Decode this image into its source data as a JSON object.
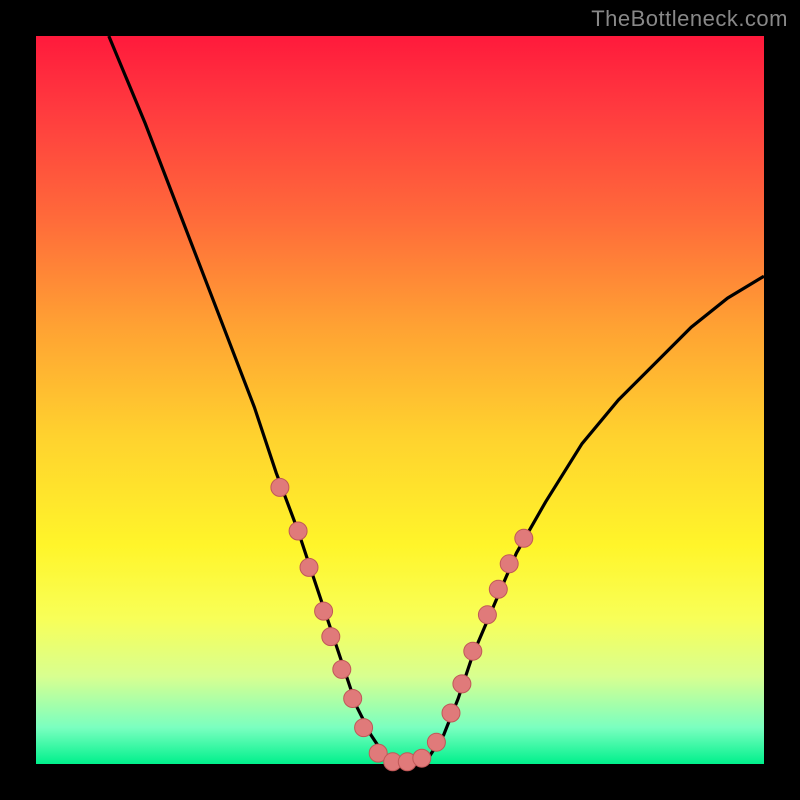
{
  "watermark": "TheBottleneck.com",
  "colors": {
    "background": "#000000",
    "curve": "#000000",
    "marker_fill": "#e07a7a",
    "marker_stroke": "#c05858"
  },
  "chart_data": {
    "type": "line",
    "title": "",
    "xlabel": "",
    "ylabel": "",
    "xlim": [
      0,
      100
    ],
    "ylim": [
      0,
      100
    ],
    "grid": false,
    "series": [
      {
        "name": "bottleneck-curve",
        "x": [
          10,
          15,
          20,
          25,
          30,
          33,
          36,
          38,
          40,
          42,
          44,
          46,
          48,
          50,
          52,
          54,
          56,
          58,
          60,
          63,
          66,
          70,
          75,
          80,
          85,
          90,
          95,
          100
        ],
        "y": [
          100,
          88,
          75,
          62,
          49,
          40,
          32,
          26,
          20,
          14,
          8,
          4,
          1,
          0,
          0,
          1,
          4,
          9,
          15,
          22,
          29,
          36,
          44,
          50,
          55,
          60,
          64,
          67
        ]
      }
    ],
    "markers": {
      "name": "highlighted-points",
      "x": [
        33.5,
        36.0,
        37.5,
        39.5,
        40.5,
        42.0,
        43.5,
        45.0,
        47.0,
        49.0,
        51.0,
        53.0,
        55.0,
        57.0,
        58.5,
        60.0,
        62.0,
        63.5,
        65.0,
        67.0
      ],
      "y": [
        38.0,
        32.0,
        27.0,
        21.0,
        17.5,
        13.0,
        9.0,
        5.0,
        1.5,
        0.3,
        0.3,
        0.8,
        3.0,
        7.0,
        11.0,
        15.5,
        20.5,
        24.0,
        27.5,
        31.0
      ]
    }
  }
}
